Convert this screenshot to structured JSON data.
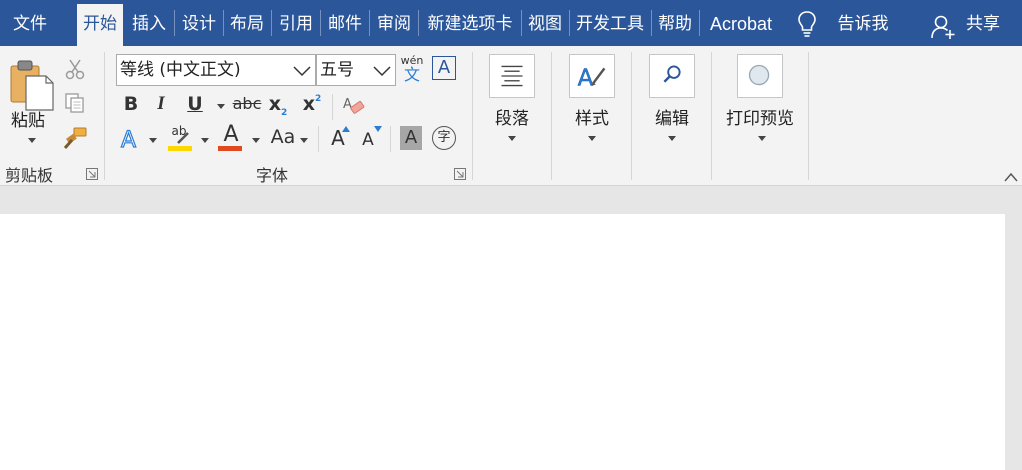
{
  "tabs": [
    {
      "label": "文件",
      "active": false
    },
    {
      "label": "开始",
      "active": true
    },
    {
      "label": "插入",
      "active": false
    },
    {
      "label": "设计",
      "active": false
    },
    {
      "label": "布局",
      "active": false
    },
    {
      "label": "引用",
      "active": false
    },
    {
      "label": "邮件",
      "active": false
    },
    {
      "label": "审阅",
      "active": false
    },
    {
      "label": "新建选项卡",
      "active": false
    },
    {
      "label": "视图",
      "active": false
    },
    {
      "label": "开发工具",
      "active": false
    },
    {
      "label": "帮助",
      "active": false
    },
    {
      "label": "Acrobat",
      "active": false
    }
  ],
  "tell_me": "告诉我",
  "share": "共享",
  "clipboard": {
    "paste_label": "粘贴",
    "group_label": "剪贴板"
  },
  "font": {
    "font_name": "等线 (中文正文)",
    "font_size": "五号",
    "phonetic_top": "wén",
    "phonetic_bottom": "文",
    "bold": "B",
    "italic": "I",
    "underline": "U",
    "strike": "abc",
    "subscript": "x",
    "superscript": "x",
    "highlight_ab": "ab",
    "font_color_a": "A",
    "change_case": "Aa",
    "grow_a": "A",
    "shrink_a": "A",
    "shade_a": "A",
    "enclose_char": "字",
    "text_effect_a": "A",
    "border_a": "A",
    "group_label": "字体"
  },
  "paragraph": {
    "label": "段落"
  },
  "styles": {
    "label": "样式"
  },
  "editing": {
    "label": "编辑"
  },
  "print_preview": {
    "label": "打印预览"
  },
  "colors": {
    "tab_bar": "#2b579a",
    "ribbon": "#f3f3f3",
    "highlight_yellow": "#ffd700",
    "font_color_red": "#e04a1f",
    "accent_blue": "#2b579a"
  }
}
